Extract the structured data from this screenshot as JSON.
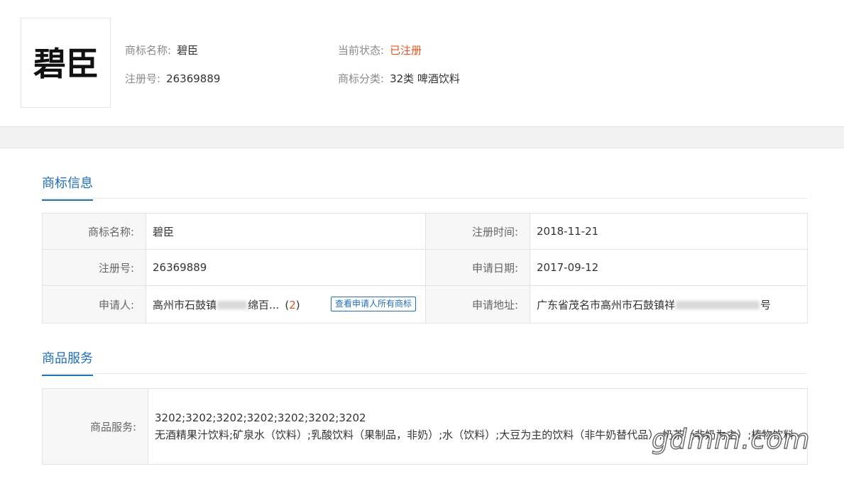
{
  "header": {
    "logo_text": "碧臣",
    "name_label": "商标名称:",
    "name_value": "碧臣",
    "reg_label": "注册号:",
    "reg_value": "26369889",
    "status_label": "当前状态:",
    "status_value": "已注册",
    "class_label": "商标分类:",
    "class_value": "32类 啤酒饮料",
    "status_color": "#e0541f"
  },
  "trademark_info": {
    "title": "商标信息",
    "rows": [
      {
        "l1": "商标名称:",
        "v1": "碧臣",
        "l2": "注册时间:",
        "v2": "2018-11-21"
      },
      {
        "l1": "注册号:",
        "v1": "26369889",
        "l2": "申请日期:",
        "v2": "2017-09-12"
      }
    ],
    "applicant_label": "申请人:",
    "applicant_prefix": "高州市石鼓镇",
    "applicant_mid": "绵百...",
    "applicant_count_open": "(",
    "applicant_count": "2",
    "applicant_count_close": ")",
    "applicant_button": "查看申请人所有商标",
    "address_label": "申请地址:",
    "address_prefix": "广东省茂名市高州市石鼓镇祥",
    "address_suffix": "号"
  },
  "goods_services": {
    "title": "商品服务",
    "label": "商品服务:",
    "codes": "3202;3202;3202;3202;3202;3202;3202",
    "items": "无酒精果汁饮料;矿泉水（饮料）;乳酸饮料（果制品，非奶）;水（饮料）;大豆为主的饮料（非牛奶替代品）;奶茶（非奶为主）;植物饮料"
  },
  "watermark": "gdmm.com",
  "colors": {
    "accent": "#1f6fb5",
    "status": "#e0541f"
  }
}
